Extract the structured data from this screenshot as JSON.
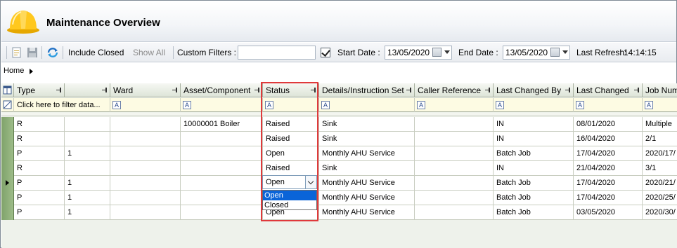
{
  "title": "Maintenance Overview",
  "toolbar": {
    "include_closed_label": "Include Closed",
    "show_all_label": "Show All",
    "custom_filters_label": "Custom Filters :",
    "custom_filters_value": "",
    "start_date_label": "Start Date :",
    "start_date_value": "13/05/2020",
    "end_date_label": "End Date :",
    "end_date_value": "13/05/2020",
    "last_refresh_label": "Last Refresh:",
    "last_refresh_value": "14:14:15"
  },
  "breadcrumb": {
    "home": "Home"
  },
  "grid": {
    "columns": [
      "Type",
      "",
      "Ward",
      "Asset/Component",
      "Status",
      "Details/Instruction Set",
      "Caller Reference",
      "Last Changed By",
      "Last Changed",
      "Job Num"
    ],
    "filter_placeholder": "Click here to filter data...",
    "filter_glyph": "A",
    "rows": [
      [
        "R",
        "",
        "",
        "10000001 Boiler",
        "Raised",
        "Sink",
        "",
        "IN",
        "08/01/2020",
        "Multiple"
      ],
      [
        "R",
        "",
        "",
        "",
        "Raised",
        "Sink",
        "",
        "IN",
        "16/04/2020",
        "2/1"
      ],
      [
        "P",
        "1",
        "",
        "",
        "Open",
        "Monthly AHU Service",
        "",
        "Batch Job",
        "17/04/2020",
        "2020/17/"
      ],
      [
        "R",
        "",
        "",
        "",
        "Raised",
        "Sink",
        "",
        "IN",
        "21/04/2020",
        "3/1"
      ],
      [
        "P",
        "1",
        "",
        "",
        "Open",
        "Monthly AHU Service",
        "",
        "Batch Job",
        "17/04/2020",
        "2020/21/"
      ],
      [
        "P",
        "1",
        "",
        "",
        "Open",
        "Monthly AHU Service",
        "",
        "Batch Job",
        "17/04/2020",
        "2020/25/"
      ],
      [
        "P",
        "1",
        "",
        "",
        "Open",
        "Monthly AHU Service",
        "",
        "Batch Job",
        "03/05/2020",
        "2020/30/"
      ]
    ]
  },
  "status_dropdown": {
    "current": "Open",
    "options": [
      "Open",
      "Closed"
    ],
    "selected": "Open"
  }
}
